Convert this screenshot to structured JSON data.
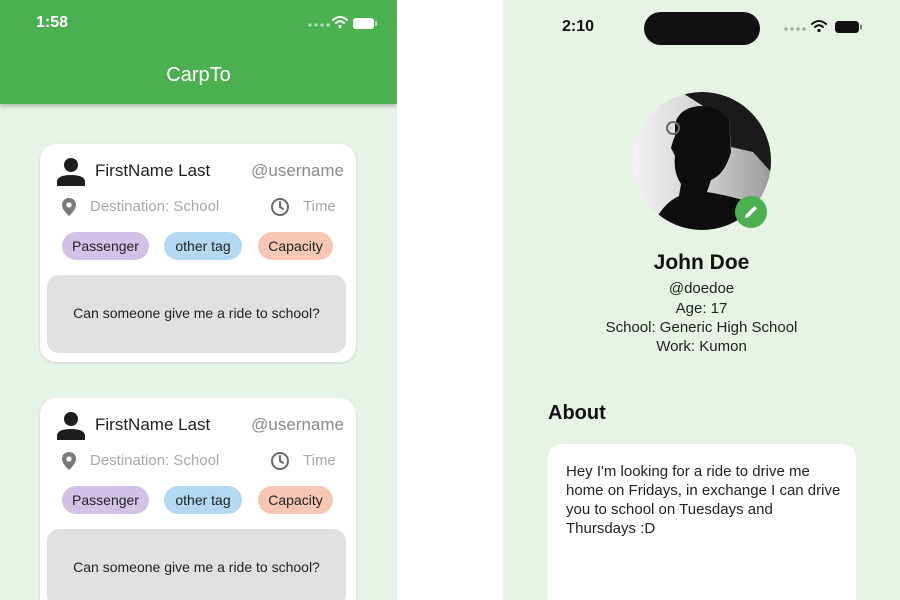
{
  "left_screen": {
    "status_bar": {
      "time": "1:58"
    },
    "app_title": "CarpTo",
    "posts": [
      {
        "name": "FirstName Last",
        "username": "@username",
        "destination": "Destination: School",
        "time": "Time",
        "tags": [
          "Passenger",
          "other tag",
          "Capacity"
        ],
        "message": "Can someone give me a ride to school?"
      },
      {
        "name": "FirstName Last",
        "username": "@username",
        "destination": "Destination: School",
        "time": "Time",
        "tags": [
          "Passenger",
          "other tag",
          "Capacity"
        ],
        "message": "Can someone give me a ride to school?"
      }
    ]
  },
  "right_screen": {
    "status_bar": {
      "time": "2:10"
    },
    "profile": {
      "name": "John Doe",
      "username": "@doedoe",
      "age": "Age: 17",
      "school": "School: Generic High School",
      "work": "Work: Kumon"
    },
    "about": {
      "heading": "About",
      "text": "Hey I'm looking for a ride to drive me home on Fridays, in exchange I can drive you to school on Tuesdays and Thursdays :D"
    }
  },
  "icons": {
    "status": [
      "signal-icon",
      "wifi-icon",
      "battery-icon"
    ],
    "post": [
      "person-icon",
      "location-pin-icon",
      "clock-icon"
    ],
    "profile": [
      "avatar-photo",
      "edit-pencil-icon"
    ]
  },
  "colors": {
    "primary_green": "#4caf50",
    "background": "#e7f3e6",
    "tag_passenger": "#d3c2e8",
    "tag_other": "#b3d8f2",
    "tag_capacity": "#f7c6b4",
    "message_bg": "#e0e0e0"
  }
}
